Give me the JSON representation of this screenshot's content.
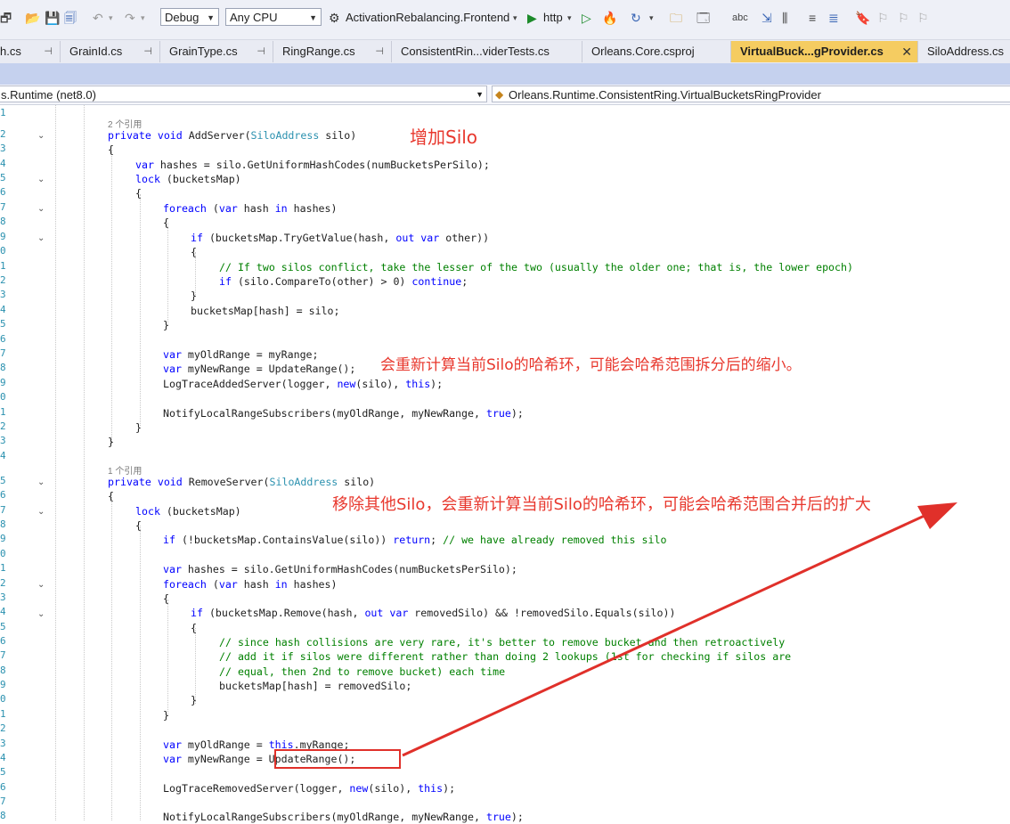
{
  "toolbar": {
    "config": "Debug",
    "platform": "Any CPU",
    "startup_project": "ActivationRebalancing.Frontend",
    "run_profile": "http"
  },
  "tabs": [
    {
      "label": "h.cs"
    },
    {
      "label": "GrainId.cs"
    },
    {
      "label": "GrainType.cs"
    },
    {
      "label": "RingRange.cs"
    },
    {
      "label": "ConsistentRin...viderTests.cs"
    },
    {
      "label": "Orleans.Core.csproj"
    },
    {
      "label": "VirtualBuck...gProvider.cs"
    },
    {
      "label": "SiloAddress.cs"
    }
  ],
  "navbar": {
    "project": "s.Runtime (net8.0)",
    "type": "Orleans.Runtime.ConsistentRing.VirtualBucketsRingProvider"
  },
  "line_numbers": [
    "1",
    "2",
    "3",
    "4",
    "5",
    "6",
    "7",
    "8",
    "9",
    "0",
    "1",
    "2",
    "3",
    "4",
    "5",
    "6",
    "7",
    "8",
    "9",
    "0",
    "1",
    "2",
    "3",
    "4",
    "5",
    "6",
    "7",
    "8",
    "9",
    "0",
    "1",
    "2",
    "3",
    "4",
    "5",
    "6",
    "7",
    "8",
    "9",
    "0",
    "1",
    "2",
    "3",
    "4",
    "5",
    "6",
    "7",
    "8"
  ],
  "code": {
    "refs_add": "2 个引用",
    "refs_remove": "1 个引用",
    "l2": "private void AddServer(SiloAddress silo)",
    "l3": "{",
    "l4": "var hashes = silo.GetUniformHashCodes(numBucketsPerSilo);",
    "l5": "lock (bucketsMap)",
    "l6": "{",
    "l7": "foreach (var hash in hashes)",
    "l8": "{",
    "l9": "if (bucketsMap.TryGetValue(hash, out var other))",
    "l10": "{",
    "l11": "// If two silos conflict, take the lesser of the two (usually the older one; that is, the lower epoch)",
    "l12": "if (silo.CompareTo(other) > 0) continue;",
    "l13": "}",
    "l14": "bucketsMap[hash] = silo;",
    "l15": "}",
    "l17": "var myOldRange = myRange;",
    "l18": "var myNewRange = UpdateRange();",
    "l19": "LogTraceAddedServer(logger, new(silo), this);",
    "l21": "NotifyLocalRangeSubscribers(myOldRange, myNewRange, true);",
    "l22": "}",
    "l23": "}",
    "l25": "private void RemoveServer(SiloAddress silo)",
    "l26": "{",
    "l27": "lock (bucketsMap)",
    "l28": "{",
    "l29": "if (!bucketsMap.ContainsValue(silo)) return; // we have already removed this silo",
    "l31": "var hashes = silo.GetUniformHashCodes(numBucketsPerSilo);",
    "l32": "foreach (var hash in hashes)",
    "l33": "{",
    "l34": "if (bucketsMap.Remove(hash, out var removedSilo) && !removedSilo.Equals(silo))",
    "l35": "{",
    "l36": "// since hash collisions are very rare, it's better to remove bucket and then retroactively",
    "l37": "// add it if silos were different rather than doing 2 lookups (1st for checking if silos are",
    "l38": "// equal, then 2nd to remove bucket) each time",
    "l39": "bucketsMap[hash] = removedSilo;",
    "l40": "}",
    "l41": "}",
    "l43": "var myOldRange = this.myRange;",
    "l44": "var myNewRange = UpdateRange();",
    "l46": "LogTraceRemovedServer(logger, new(silo), this);",
    "l48": "NotifyLocalRangeSubscribers(myOldRange, myNewRange, true);"
  },
  "annotations": {
    "add_silo": "增加Silo",
    "recalc_shrink": "会重新计算当前Silo的哈希环，可能会哈希范围拆分后的缩小。",
    "remove_expand": "移除其他Silo，会重新计算当前Silo的哈希环，可能会哈希范围合并后的扩大",
    "color": "#e8382e"
  }
}
